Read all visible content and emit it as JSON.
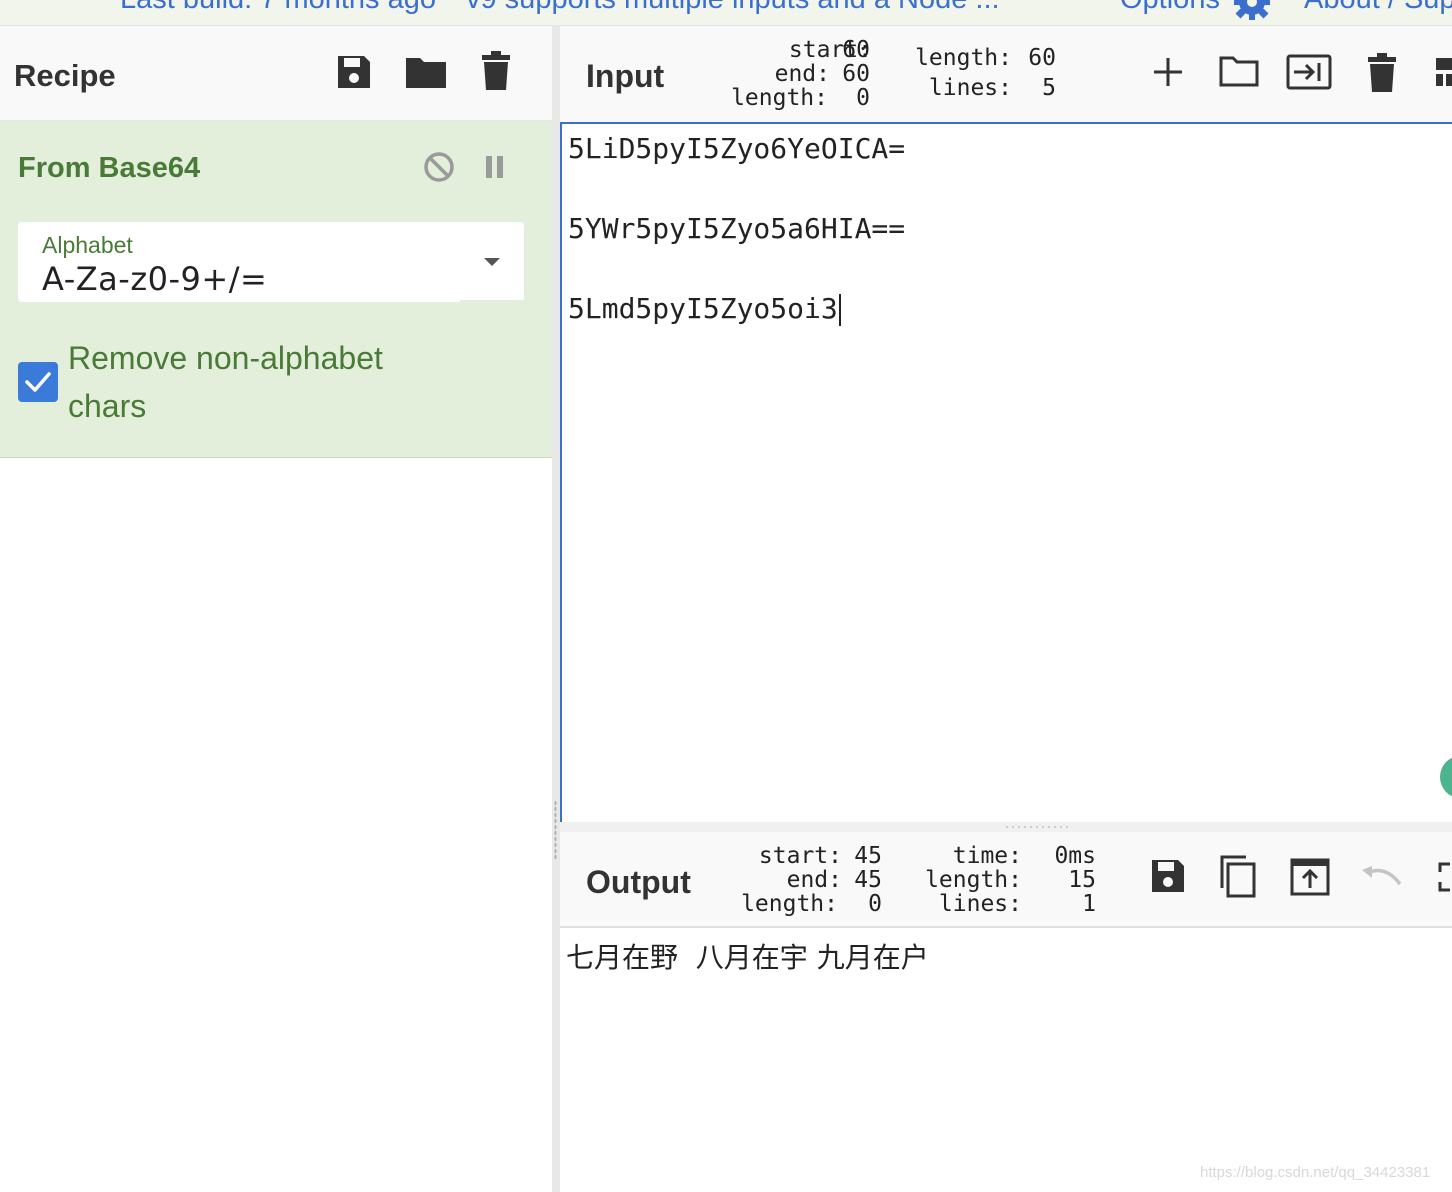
{
  "topbar": {
    "last_build": "Last build: 7 months ago",
    "news": "v9 supports multiple inputs and a Node ...",
    "options": "Options",
    "about": "About / Sup"
  },
  "recipe": {
    "title": "Recipe",
    "operation": {
      "name": "From Base64",
      "alphabet_label": "Alphabet",
      "alphabet_value": "A-Za-z0-9+/=",
      "remove_non_alphabet_checked": true,
      "remove_non_alphabet_label": "Remove non-alphabet chars"
    }
  },
  "input": {
    "title": "Input",
    "stats": {
      "start_label": "start:",
      "start": "60",
      "end_label": "end:",
      "end": "60",
      "sel_length_label": "length:",
      "sel_length": "0",
      "length_label": "length:",
      "length": "60",
      "lines_label": "lines:",
      "lines": "5"
    },
    "lines": [
      "5LiD5pyI5Zyo6YeOICA=",
      "",
      "5YWr5pyI5Zyo5a6HIA==",
      "",
      "5Lmd5pyI5Zyo5oi3"
    ]
  },
  "output": {
    "title": "Output",
    "stats": {
      "start_label": "start:",
      "start": "45",
      "end_label": "end:",
      "end": "45",
      "sel_length_label": "length:",
      "sel_length": "0",
      "time_label": "time:",
      "time": "0ms",
      "length_label": "length:",
      "length": "15",
      "lines_label": "lines:",
      "lines": "1"
    },
    "text": "七月在野  八月在宇 九月在户"
  },
  "watermark": "https://blog.csdn.net/qq_34423381",
  "colors": {
    "accent_blue": "#3a6fce",
    "operation_bg": "#e3efdb",
    "operation_text": "#4a7a37",
    "checkbox": "#3a7ad8"
  }
}
